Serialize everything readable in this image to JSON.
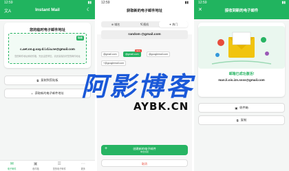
{
  "panel1": {
    "status_time": "12:59",
    "app_title": "Instant Mail",
    "lang_label": "文A",
    "card_label": "您的临时电子邮件地址",
    "badge": "隐藏",
    "email": "c.aet.on.g.vay.d.l.d.ia.ne@gmail.com",
    "hint": "您的邮件地址和收件箱，完全由您掌控，请妥善保存好您的邮件地址",
    "copy_label": "复制到剪贴板",
    "new_label": "获取新的电子邮件地址",
    "tabs": [
      {
        "label": "电子邮件",
        "icon": "mail-icon"
      },
      {
        "label": "收件箱",
        "icon": "inbox-icon"
      },
      {
        "label": "您的电子邮件",
        "icon": "list-icon"
      },
      {
        "label": "更多",
        "icon": "more-icon"
      }
    ]
  },
  "panel2": {
    "status_time": "12:59",
    "title": "获取新的电子邮件地址",
    "segments": [
      "域名",
      "随机",
      "热门"
    ],
    "input_value": "random @gmail.com",
    "chips": [
      "@gmail.com",
      "@gmail.com",
      "@googlemail.com",
      "+@googlemail.com"
    ],
    "chip_new": "NEW",
    "create_label": "创建新的电子邮件",
    "create_sub": "单击创建",
    "cancel_label": "取消"
  },
  "panel3": {
    "status_time": "12:59",
    "title": "接收到新的电子邮件",
    "success": "邮箱已成功激活!",
    "email": "man.li.ois.izn.ssss@gmail.com",
    "inbox_label": "收件箱",
    "copy_label": "复制"
  },
  "watermark": {
    "main": "阿影博客",
    "sub": "AYBK.CN"
  },
  "colors": {
    "brand": "#21b45f",
    "accent": "#27b463",
    "danger": "#e74c3c",
    "watermark": "#1a58d8"
  }
}
